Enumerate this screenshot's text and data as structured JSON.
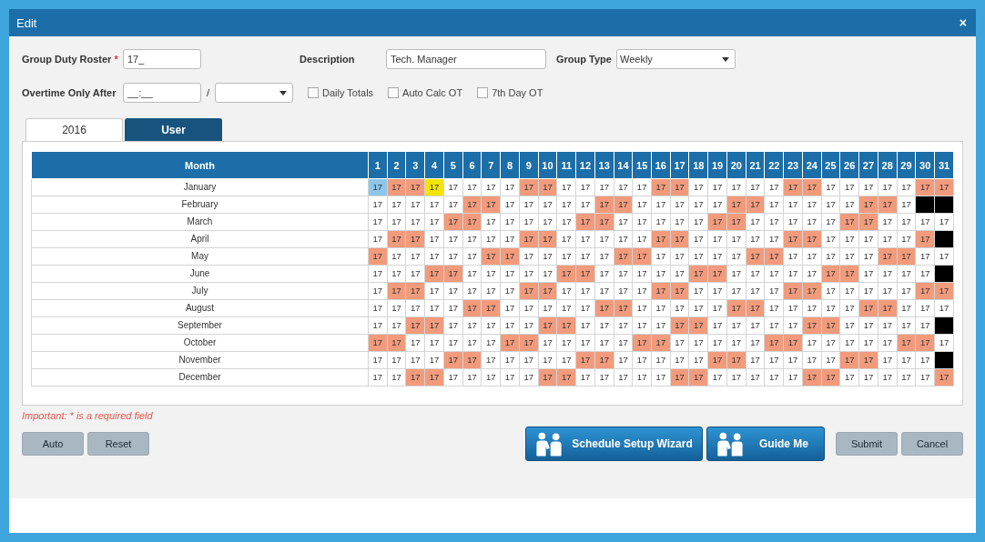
{
  "window": {
    "title": "Edit",
    "close": "×"
  },
  "form": {
    "roster": {
      "label": "Group Duty Roster",
      "required_mark": "*",
      "value": "17_"
    },
    "description": {
      "label": "Description",
      "value": "Tech. Manager"
    },
    "group_type": {
      "label": "Group Type",
      "value": "Weekly"
    },
    "overtime": {
      "label": "Overtime Only After",
      "value": "__:__",
      "separator": "/"
    },
    "checkboxes": [
      {
        "label": "Daily Totals",
        "checked": false
      },
      {
        "label": "Auto Calc OT",
        "checked": false
      },
      {
        "label": "7th Day OT",
        "checked": false
      }
    ]
  },
  "tabs": [
    {
      "label": "2016",
      "selected": true
    },
    {
      "label": "User",
      "selected": false
    }
  ],
  "table": {
    "month_header": "Month",
    "columns": [
      "1",
      "2",
      "3",
      "4",
      "5",
      "6",
      "7",
      "8",
      "9",
      "10",
      "11",
      "12",
      "13",
      "14",
      "15",
      "16",
      "17",
      "18",
      "19",
      "20",
      "21",
      "22",
      "23",
      "24",
      "25",
      "26",
      "27",
      "28",
      "29",
      "30",
      "31"
    ],
    "rows": [
      {
        "month": "January",
        "cells": [
          {
            "text": "17",
            "kind": "selected"
          },
          {
            "text": "17",
            "kind": "weekend"
          },
          {
            "text": "17",
            "kind": "weekend"
          },
          {
            "text": "17",
            "kind": "highlight"
          },
          {
            "text": "17",
            "kind": "day"
          },
          {
            "text": "17",
            "kind": "day"
          },
          {
            "text": "17",
            "kind": "day"
          },
          {
            "text": "17",
            "kind": "day"
          },
          {
            "text": "17",
            "kind": "weekend"
          },
          {
            "text": "17",
            "kind": "weekend"
          },
          {
            "text": "17",
            "kind": "day"
          },
          {
            "text": "17",
            "kind": "day"
          },
          {
            "text": "17",
            "kind": "day"
          },
          {
            "text": "17",
            "kind": "day"
          },
          {
            "text": "17",
            "kind": "day"
          },
          {
            "text": "17",
            "kind": "weekend"
          },
          {
            "text": "17",
            "kind": "weekend"
          },
          {
            "text": "17",
            "kind": "day"
          },
          {
            "text": "17",
            "kind": "day"
          },
          {
            "text": "17",
            "kind": "day"
          },
          {
            "text": "17",
            "kind": "day"
          },
          {
            "text": "17",
            "kind": "day"
          },
          {
            "text": "17",
            "kind": "weekend"
          },
          {
            "text": "17",
            "kind": "weekend"
          },
          {
            "text": "17",
            "kind": "day"
          },
          {
            "text": "17",
            "kind": "day"
          },
          {
            "text": "17",
            "kind": "day"
          },
          {
            "text": "17",
            "kind": "day"
          },
          {
            "text": "17",
            "kind": "day"
          },
          {
            "text": "17",
            "kind": "weekend"
          },
          {
            "text": "17",
            "kind": "weekend"
          }
        ]
      },
      {
        "month": "February",
        "cells": [
          {
            "text": "17",
            "kind": "day"
          },
          {
            "text": "17",
            "kind": "day"
          },
          {
            "text": "17",
            "kind": "day"
          },
          {
            "text": "17",
            "kind": "day"
          },
          {
            "text": "17",
            "kind": "day"
          },
          {
            "text": "17",
            "kind": "weekend"
          },
          {
            "text": "17",
            "kind": "weekend"
          },
          {
            "text": "17",
            "kind": "day"
          },
          {
            "text": "17",
            "kind": "day"
          },
          {
            "text": "17",
            "kind": "day"
          },
          {
            "text": "17",
            "kind": "day"
          },
          {
            "text": "17",
            "kind": "day"
          },
          {
            "text": "17",
            "kind": "weekend"
          },
          {
            "text": "17",
            "kind": "weekend"
          },
          {
            "text": "17",
            "kind": "day"
          },
          {
            "text": "17",
            "kind": "day"
          },
          {
            "text": "17",
            "kind": "day"
          },
          {
            "text": "17",
            "kind": "day"
          },
          {
            "text": "17",
            "kind": "day"
          },
          {
            "text": "17",
            "kind": "weekend"
          },
          {
            "text": "17",
            "kind": "weekend"
          },
          {
            "text": "17",
            "kind": "day"
          },
          {
            "text": "17",
            "kind": "day"
          },
          {
            "text": "17",
            "kind": "day"
          },
          {
            "text": "17",
            "kind": "day"
          },
          {
            "text": "17",
            "kind": "day"
          },
          {
            "text": "17",
            "kind": "weekend"
          },
          {
            "text": "17",
            "kind": "weekend"
          },
          {
            "text": "17",
            "kind": "day"
          },
          {
            "kind": "blank"
          },
          {
            "kind": "blank"
          }
        ]
      },
      {
        "month": "March",
        "cells": [
          {
            "text": "17",
            "kind": "day"
          },
          {
            "text": "17",
            "kind": "day"
          },
          {
            "text": "17",
            "kind": "day"
          },
          {
            "text": "17",
            "kind": "day"
          },
          {
            "text": "17",
            "kind": "weekend"
          },
          {
            "text": "17",
            "kind": "weekend"
          },
          {
            "text": "17",
            "kind": "day"
          },
          {
            "text": "17",
            "kind": "day"
          },
          {
            "text": "17",
            "kind": "day"
          },
          {
            "text": "17",
            "kind": "day"
          },
          {
            "text": "17",
            "kind": "day"
          },
          {
            "text": "17",
            "kind": "weekend"
          },
          {
            "text": "17",
            "kind": "weekend"
          },
          {
            "text": "17",
            "kind": "day"
          },
          {
            "text": "17",
            "kind": "day"
          },
          {
            "text": "17",
            "kind": "day"
          },
          {
            "text": "17",
            "kind": "day"
          },
          {
            "text": "17",
            "kind": "day"
          },
          {
            "text": "17",
            "kind": "weekend"
          },
          {
            "text": "17",
            "kind": "weekend"
          },
          {
            "text": "17",
            "kind": "day"
          },
          {
            "text": "17",
            "kind": "day"
          },
          {
            "text": "17",
            "kind": "day"
          },
          {
            "text": "17",
            "kind": "day"
          },
          {
            "text": "17",
            "kind": "day"
          },
          {
            "text": "17",
            "kind": "weekend"
          },
          {
            "text": "17",
            "kind": "weekend"
          },
          {
            "text": "17",
            "kind": "day"
          },
          {
            "text": "17",
            "kind": "day"
          },
          {
            "text": "17",
            "kind": "day"
          },
          {
            "text": "17",
            "kind": "day"
          }
        ]
      },
      {
        "month": "April",
        "cells": [
          {
            "text": "17",
            "kind": "day"
          },
          {
            "text": "17",
            "kind": "weekend"
          },
          {
            "text": "17",
            "kind": "weekend"
          },
          {
            "text": "17",
            "kind": "day"
          },
          {
            "text": "17",
            "kind": "day"
          },
          {
            "text": "17",
            "kind": "day"
          },
          {
            "text": "17",
            "kind": "day"
          },
          {
            "text": "17",
            "kind": "day"
          },
          {
            "text": "17",
            "kind": "weekend"
          },
          {
            "text": "17",
            "kind": "weekend"
          },
          {
            "text": "17",
            "kind": "day"
          },
          {
            "text": "17",
            "kind": "day"
          },
          {
            "text": "17",
            "kind": "day"
          },
          {
            "text": "17",
            "kind": "day"
          },
          {
            "text": "17",
            "kind": "day"
          },
          {
            "text": "17",
            "kind": "weekend"
          },
          {
            "text": "17",
            "kind": "weekend"
          },
          {
            "text": "17",
            "kind": "day"
          },
          {
            "text": "17",
            "kind": "day"
          },
          {
            "text": "17",
            "kind": "day"
          },
          {
            "text": "17",
            "kind": "day"
          },
          {
            "text": "17",
            "kind": "day"
          },
          {
            "text": "17",
            "kind": "weekend"
          },
          {
            "text": "17",
            "kind": "weekend"
          },
          {
            "text": "17",
            "kind": "day"
          },
          {
            "text": "17",
            "kind": "day"
          },
          {
            "text": "17",
            "kind": "day"
          },
          {
            "text": "17",
            "kind": "day"
          },
          {
            "text": "17",
            "kind": "day"
          },
          {
            "text": "17",
            "kind": "weekend"
          },
          {
            "kind": "blank"
          }
        ]
      },
      {
        "month": "May",
        "cells": [
          {
            "text": "17",
            "kind": "weekend"
          },
          {
            "text": "17",
            "kind": "day"
          },
          {
            "text": "17",
            "kind": "day"
          },
          {
            "text": "17",
            "kind": "day"
          },
          {
            "text": "17",
            "kind": "day"
          },
          {
            "text": "17",
            "kind": "day"
          },
          {
            "text": "17",
            "kind": "weekend"
          },
          {
            "text": "17",
            "kind": "weekend"
          },
          {
            "text": "17",
            "kind": "day"
          },
          {
            "text": "17",
            "kind": "day"
          },
          {
            "text": "17",
            "kind": "day"
          },
          {
            "text": "17",
            "kind": "day"
          },
          {
            "text": "17",
            "kind": "day"
          },
          {
            "text": "17",
            "kind": "weekend"
          },
          {
            "text": "17",
            "kind": "weekend"
          },
          {
            "text": "17",
            "kind": "day"
          },
          {
            "text": "17",
            "kind": "day"
          },
          {
            "text": "17",
            "kind": "day"
          },
          {
            "text": "17",
            "kind": "day"
          },
          {
            "text": "17",
            "kind": "day"
          },
          {
            "text": "17",
            "kind": "weekend"
          },
          {
            "text": "17",
            "kind": "weekend"
          },
          {
            "text": "17",
            "kind": "day"
          },
          {
            "text": "17",
            "kind": "day"
          },
          {
            "text": "17",
            "kind": "day"
          },
          {
            "text": "17",
            "kind": "day"
          },
          {
            "text": "17",
            "kind": "day"
          },
          {
            "text": "17",
            "kind": "weekend"
          },
          {
            "text": "17",
            "kind": "weekend"
          },
          {
            "text": "17",
            "kind": "day"
          },
          {
            "text": "17",
            "kind": "day"
          }
        ]
      },
      {
        "month": "June",
        "cells": [
          {
            "text": "17",
            "kind": "day"
          },
          {
            "text": "17",
            "kind": "day"
          },
          {
            "text": "17",
            "kind": "day"
          },
          {
            "text": "17",
            "kind": "weekend"
          },
          {
            "text": "17",
            "kind": "weekend"
          },
          {
            "text": "17",
            "kind": "day"
          },
          {
            "text": "17",
            "kind": "day"
          },
          {
            "text": "17",
            "kind": "day"
          },
          {
            "text": "17",
            "kind": "day"
          },
          {
            "text": "17",
            "kind": "day"
          },
          {
            "text": "17",
            "kind": "weekend"
          },
          {
            "text": "17",
            "kind": "weekend"
          },
          {
            "text": "17",
            "kind": "day"
          },
          {
            "text": "17",
            "kind": "day"
          },
          {
            "text": "17",
            "kind": "day"
          },
          {
            "text": "17",
            "kind": "day"
          },
          {
            "text": "17",
            "kind": "day"
          },
          {
            "text": "17",
            "kind": "weekend"
          },
          {
            "text": "17",
            "kind": "weekend"
          },
          {
            "text": "17",
            "kind": "day"
          },
          {
            "text": "17",
            "kind": "day"
          },
          {
            "text": "17",
            "kind": "day"
          },
          {
            "text": "17",
            "kind": "day"
          },
          {
            "text": "17",
            "kind": "day"
          },
          {
            "text": "17",
            "kind": "weekend"
          },
          {
            "text": "17",
            "kind": "weekend"
          },
          {
            "text": "17",
            "kind": "day"
          },
          {
            "text": "17",
            "kind": "day"
          },
          {
            "text": "17",
            "kind": "day"
          },
          {
            "text": "17",
            "kind": "day"
          },
          {
            "kind": "blank"
          }
        ]
      },
      {
        "month": "July",
        "cells": [
          {
            "text": "17",
            "kind": "day"
          },
          {
            "text": "17",
            "kind": "weekend"
          },
          {
            "text": "17",
            "kind": "weekend"
          },
          {
            "text": "17",
            "kind": "day"
          },
          {
            "text": "17",
            "kind": "day"
          },
          {
            "text": "17",
            "kind": "day"
          },
          {
            "text": "17",
            "kind": "day"
          },
          {
            "text": "17",
            "kind": "day"
          },
          {
            "text": "17",
            "kind": "weekend"
          },
          {
            "text": "17",
            "kind": "weekend"
          },
          {
            "text": "17",
            "kind": "day"
          },
          {
            "text": "17",
            "kind": "day"
          },
          {
            "text": "17",
            "kind": "day"
          },
          {
            "text": "17",
            "kind": "day"
          },
          {
            "text": "17",
            "kind": "day"
          },
          {
            "text": "17",
            "kind": "weekend"
          },
          {
            "text": "17",
            "kind": "weekend"
          },
          {
            "text": "17",
            "kind": "day"
          },
          {
            "text": "17",
            "kind": "day"
          },
          {
            "text": "17",
            "kind": "day"
          },
          {
            "text": "17",
            "kind": "day"
          },
          {
            "text": "17",
            "kind": "day"
          },
          {
            "text": "17",
            "kind": "weekend"
          },
          {
            "text": "17",
            "kind": "weekend"
          },
          {
            "text": "17",
            "kind": "day"
          },
          {
            "text": "17",
            "kind": "day"
          },
          {
            "text": "17",
            "kind": "day"
          },
          {
            "text": "17",
            "kind": "day"
          },
          {
            "text": "17",
            "kind": "day"
          },
          {
            "text": "17",
            "kind": "weekend"
          },
          {
            "text": "17",
            "kind": "weekend"
          }
        ]
      },
      {
        "month": "August",
        "cells": [
          {
            "text": "17",
            "kind": "day"
          },
          {
            "text": "17",
            "kind": "day"
          },
          {
            "text": "17",
            "kind": "day"
          },
          {
            "text": "17",
            "kind": "day"
          },
          {
            "text": "17",
            "kind": "day"
          },
          {
            "text": "17",
            "kind": "weekend"
          },
          {
            "text": "17",
            "kind": "weekend"
          },
          {
            "text": "17",
            "kind": "day"
          },
          {
            "text": "17",
            "kind": "day"
          },
          {
            "text": "17",
            "kind": "day"
          },
          {
            "text": "17",
            "kind": "day"
          },
          {
            "text": "17",
            "kind": "day"
          },
          {
            "text": "17",
            "kind": "weekend"
          },
          {
            "text": "17",
            "kind": "weekend"
          },
          {
            "text": "17",
            "kind": "day"
          },
          {
            "text": "17",
            "kind": "day"
          },
          {
            "text": "17",
            "kind": "day"
          },
          {
            "text": "17",
            "kind": "day"
          },
          {
            "text": "17",
            "kind": "day"
          },
          {
            "text": "17",
            "kind": "weekend"
          },
          {
            "text": "17",
            "kind": "weekend"
          },
          {
            "text": "17",
            "kind": "day"
          },
          {
            "text": "17",
            "kind": "day"
          },
          {
            "text": "17",
            "kind": "day"
          },
          {
            "text": "17",
            "kind": "day"
          },
          {
            "text": "17",
            "kind": "day"
          },
          {
            "text": "17",
            "kind": "weekend"
          },
          {
            "text": "17",
            "kind": "weekend"
          },
          {
            "text": "17",
            "kind": "day"
          },
          {
            "text": "17",
            "kind": "day"
          },
          {
            "text": "17",
            "kind": "day"
          }
        ]
      },
      {
        "month": "September",
        "cells": [
          {
            "text": "17",
            "kind": "day"
          },
          {
            "text": "17",
            "kind": "day"
          },
          {
            "text": "17",
            "kind": "weekend"
          },
          {
            "text": "17",
            "kind": "weekend"
          },
          {
            "text": "17",
            "kind": "day"
          },
          {
            "text": "17",
            "kind": "day"
          },
          {
            "text": "17",
            "kind": "day"
          },
          {
            "text": "17",
            "kind": "day"
          },
          {
            "text": "17",
            "kind": "day"
          },
          {
            "text": "17",
            "kind": "weekend"
          },
          {
            "text": "17",
            "kind": "weekend"
          },
          {
            "text": "17",
            "kind": "day"
          },
          {
            "text": "17",
            "kind": "day"
          },
          {
            "text": "17",
            "kind": "day"
          },
          {
            "text": "17",
            "kind": "day"
          },
          {
            "text": "17",
            "kind": "day"
          },
          {
            "text": "17",
            "kind": "weekend"
          },
          {
            "text": "17",
            "kind": "weekend"
          },
          {
            "text": "17",
            "kind": "day"
          },
          {
            "text": "17",
            "kind": "day"
          },
          {
            "text": "17",
            "kind": "day"
          },
          {
            "text": "17",
            "kind": "day"
          },
          {
            "text": "17",
            "kind": "day"
          },
          {
            "text": "17",
            "kind": "weekend"
          },
          {
            "text": "17",
            "kind": "weekend"
          },
          {
            "text": "17",
            "kind": "day"
          },
          {
            "text": "17",
            "kind": "day"
          },
          {
            "text": "17",
            "kind": "day"
          },
          {
            "text": "17",
            "kind": "day"
          },
          {
            "text": "17",
            "kind": "day"
          },
          {
            "kind": "blank"
          }
        ]
      },
      {
        "month": "October",
        "cells": [
          {
            "text": "17",
            "kind": "weekend"
          },
          {
            "text": "17",
            "kind": "weekend"
          },
          {
            "text": "17",
            "kind": "day"
          },
          {
            "text": "17",
            "kind": "day"
          },
          {
            "text": "17",
            "kind": "day"
          },
          {
            "text": "17",
            "kind": "day"
          },
          {
            "text": "17",
            "kind": "day"
          },
          {
            "text": "17",
            "kind": "weekend"
          },
          {
            "text": "17",
            "kind": "weekend"
          },
          {
            "text": "17",
            "kind": "day"
          },
          {
            "text": "17",
            "kind": "day"
          },
          {
            "text": "17",
            "kind": "day"
          },
          {
            "text": "17",
            "kind": "day"
          },
          {
            "text": "17",
            "kind": "day"
          },
          {
            "text": "17",
            "kind": "weekend"
          },
          {
            "text": "17",
            "kind": "weekend"
          },
          {
            "text": "17",
            "kind": "day"
          },
          {
            "text": "17",
            "kind": "day"
          },
          {
            "text": "17",
            "kind": "day"
          },
          {
            "text": "17",
            "kind": "day"
          },
          {
            "text": "17",
            "kind": "day"
          },
          {
            "text": "17",
            "kind": "weekend"
          },
          {
            "text": "17",
            "kind": "weekend"
          },
          {
            "text": "17",
            "kind": "day"
          },
          {
            "text": "17",
            "kind": "day"
          },
          {
            "text": "17",
            "kind": "day"
          },
          {
            "text": "17",
            "kind": "day"
          },
          {
            "text": "17",
            "kind": "day"
          },
          {
            "text": "17",
            "kind": "weekend"
          },
          {
            "text": "17",
            "kind": "weekend"
          },
          {
            "text": "17",
            "kind": "day"
          }
        ]
      },
      {
        "month": "November",
        "cells": [
          {
            "text": "17",
            "kind": "day"
          },
          {
            "text": "17",
            "kind": "day"
          },
          {
            "text": "17",
            "kind": "day"
          },
          {
            "text": "17",
            "kind": "day"
          },
          {
            "text": "17",
            "kind": "weekend"
          },
          {
            "text": "17",
            "kind": "weekend"
          },
          {
            "text": "17",
            "kind": "day"
          },
          {
            "text": "17",
            "kind": "day"
          },
          {
            "text": "17",
            "kind": "day"
          },
          {
            "text": "17",
            "kind": "day"
          },
          {
            "text": "17",
            "kind": "day"
          },
          {
            "text": "17",
            "kind": "weekend"
          },
          {
            "text": "17",
            "kind": "weekend"
          },
          {
            "text": "17",
            "kind": "day"
          },
          {
            "text": "17",
            "kind": "day"
          },
          {
            "text": "17",
            "kind": "day"
          },
          {
            "text": "17",
            "kind": "day"
          },
          {
            "text": "17",
            "kind": "day"
          },
          {
            "text": "17",
            "kind": "weekend"
          },
          {
            "text": "17",
            "kind": "weekend"
          },
          {
            "text": "17",
            "kind": "day"
          },
          {
            "text": "17",
            "kind": "day"
          },
          {
            "text": "17",
            "kind": "day"
          },
          {
            "text": "17",
            "kind": "day"
          },
          {
            "text": "17",
            "kind": "day"
          },
          {
            "text": "17",
            "kind": "weekend"
          },
          {
            "text": "17",
            "kind": "weekend"
          },
          {
            "text": "17",
            "kind": "day"
          },
          {
            "text": "17",
            "kind": "day"
          },
          {
            "text": "17",
            "kind": "day"
          },
          {
            "kind": "blank"
          }
        ]
      },
      {
        "month": "December",
        "cells": [
          {
            "text": "17",
            "kind": "day"
          },
          {
            "text": "17",
            "kind": "day"
          },
          {
            "text": "17",
            "kind": "weekend"
          },
          {
            "text": "17",
            "kind": "weekend"
          },
          {
            "text": "17",
            "kind": "day"
          },
          {
            "text": "17",
            "kind": "day"
          },
          {
            "text": "17",
            "kind": "day"
          },
          {
            "text": "17",
            "kind": "day"
          },
          {
            "text": "17",
            "kind": "day"
          },
          {
            "text": "17",
            "kind": "weekend"
          },
          {
            "text": "17",
            "kind": "weekend"
          },
          {
            "text": "17",
            "kind": "day"
          },
          {
            "text": "17",
            "kind": "day"
          },
          {
            "text": "17",
            "kind": "day"
          },
          {
            "text": "17",
            "kind": "day"
          },
          {
            "text": "17",
            "kind": "day"
          },
          {
            "text": "17",
            "kind": "weekend"
          },
          {
            "text": "17",
            "kind": "weekend"
          },
          {
            "text": "17",
            "kind": "day"
          },
          {
            "text": "17",
            "kind": "day"
          },
          {
            "text": "17",
            "kind": "day"
          },
          {
            "text": "17",
            "kind": "day"
          },
          {
            "text": "17",
            "kind": "day"
          },
          {
            "text": "17",
            "kind": "weekend"
          },
          {
            "text": "17",
            "kind": "weekend"
          },
          {
            "text": "17",
            "kind": "day"
          },
          {
            "text": "17",
            "kind": "day"
          },
          {
            "text": "17",
            "kind": "day"
          },
          {
            "text": "17",
            "kind": "day"
          },
          {
            "text": "17",
            "kind": "day"
          },
          {
            "text": "17",
            "kind": "weekend"
          }
        ]
      }
    ]
  },
  "note": "Important: * is a required field",
  "left_buttons": [
    "Auto",
    "Reset"
  ],
  "wizard_buttons": [
    "Schedule Setup Wizard",
    "Guide Me"
  ],
  "right_buttons": [
    "Submit",
    "Cancel"
  ]
}
